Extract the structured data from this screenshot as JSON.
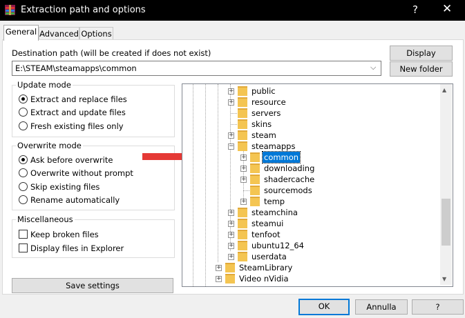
{
  "window": {
    "title": "Extraction path and options",
    "help_glyph": "?",
    "close_glyph": "✕"
  },
  "tabs": [
    "General",
    "Advanced",
    "Options"
  ],
  "destination": {
    "label": "Destination path (will be created if does not exist)",
    "value": "E:\\STEAM\\steamapps\\common"
  },
  "buttons": {
    "display": "Display",
    "new_folder": "New folder",
    "save_settings": "Save settings",
    "ok": "OK",
    "cancel": "Annulla",
    "help": "?"
  },
  "update_mode": {
    "title": "Update mode",
    "options": [
      "Extract and replace files",
      "Extract and update files",
      "Fresh existing files only"
    ],
    "selected": 0
  },
  "overwrite_mode": {
    "title": "Overwrite mode",
    "options": [
      "Ask before overwrite",
      "Overwrite without prompt",
      "Skip existing files",
      "Rename automatically"
    ],
    "selected": 0
  },
  "misc": {
    "title": "Miscellaneous",
    "options": [
      "Keep broken files",
      "Display files in Explorer"
    ]
  },
  "tree": {
    "items": [
      {
        "label": "public",
        "level": 1,
        "expander": "+"
      },
      {
        "label": "resource",
        "level": 1,
        "expander": "+"
      },
      {
        "label": "servers",
        "level": 1,
        "expander": ""
      },
      {
        "label": "skins",
        "level": 1,
        "expander": ""
      },
      {
        "label": "steam",
        "level": 1,
        "expander": "+"
      },
      {
        "label": "steamapps",
        "level": 1,
        "expander": "−"
      },
      {
        "label": "common",
        "level": 2,
        "expander": "+",
        "selected": true
      },
      {
        "label": "downloading",
        "level": 2,
        "expander": "+"
      },
      {
        "label": "shadercache",
        "level": 2,
        "expander": "+"
      },
      {
        "label": "sourcemods",
        "level": 2,
        "expander": ""
      },
      {
        "label": "temp",
        "level": 2,
        "expander": "+"
      },
      {
        "label": "steamchina",
        "level": 1,
        "expander": "+"
      },
      {
        "label": "steamui",
        "level": 1,
        "expander": "+"
      },
      {
        "label": "tenfoot",
        "level": 1,
        "expander": "+"
      },
      {
        "label": "ubuntu12_64",
        "level": 1,
        "expander": "+"
      },
      {
        "label": "userdata",
        "level": 1,
        "expander": "+"
      },
      {
        "label": "SteamLibrary",
        "level": 0,
        "expander": "+"
      },
      {
        "label": "Video nVidia",
        "level": 0,
        "expander": "+"
      }
    ]
  },
  "colors": {
    "arrow": "#e53935",
    "selection": "#0078d7",
    "folder": "#f4c552"
  }
}
